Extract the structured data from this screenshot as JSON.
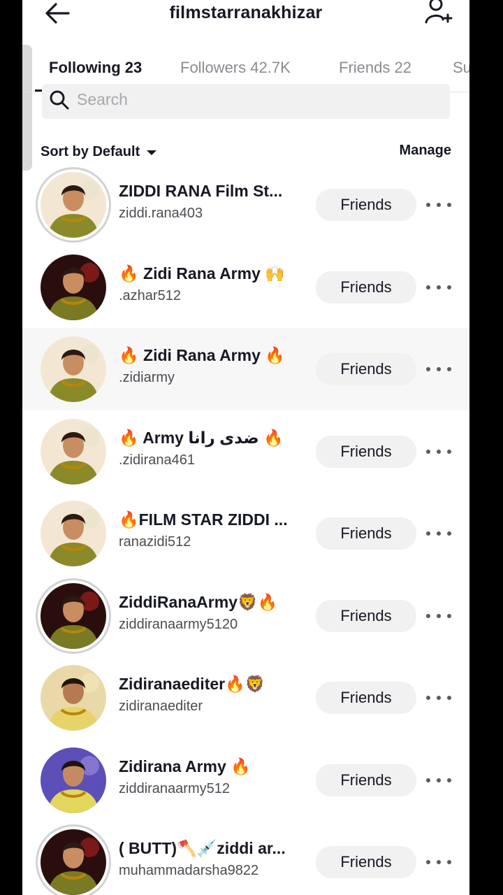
{
  "header": {
    "title": "filmstarranakhizar",
    "back_icon": "back-arrow-icon",
    "add_icon": "add-user-icon"
  },
  "tabs": [
    {
      "label": "Following 23",
      "active": true
    },
    {
      "label": "Followers 42.7K",
      "active": false
    },
    {
      "label": "Friends 22",
      "active": false
    },
    {
      "label": "Su",
      "active": false
    }
  ],
  "search": {
    "placeholder": "Search"
  },
  "sort": {
    "label": "Sort by Default",
    "manage": "Manage"
  },
  "accounts": [
    {
      "name": "ZIDDI RANA Film St...",
      "username": "ziddi.rana403",
      "button": "Friends",
      "avatar_style": "light"
    },
    {
      "name": "🔥 Zidi Rana Army 🙌",
      "username": ".azhar512",
      "button": "Friends",
      "avatar_style": "dark"
    },
    {
      "name": "🔥 Zidi Rana Army 🔥",
      "username": ".zidiarmy",
      "button": "Friends",
      "avatar_style": "light"
    },
    {
      "name": "🔥 Army ضدی رانا 🔥",
      "username": ".zidirana461",
      "button": "Friends",
      "avatar_style": "light"
    },
    {
      "name": "🔥FILM STAR ZIDDI ...",
      "username": "ranazidi512",
      "button": "Friends",
      "avatar_style": "light"
    },
    {
      "name": "ZiddiRanaArmy🦁🔥",
      "username": "ziddiranaarmy5120",
      "button": "Friends",
      "avatar_style": "dark"
    },
    {
      "name": "Zidiranaediter🔥🦁",
      "username": "zidiranaediter",
      "button": "Friends",
      "avatar_style": "yellow"
    },
    {
      "name": "Zidirana Army 🔥",
      "username": "ziddiranaarmy512",
      "button": "Friends",
      "avatar_style": "purple"
    },
    {
      "name": "( BUTT)🪓💉ziddi ar...",
      "username": "muhammadarsha9822",
      "button": "Friends",
      "avatar_style": "dark"
    }
  ]
}
